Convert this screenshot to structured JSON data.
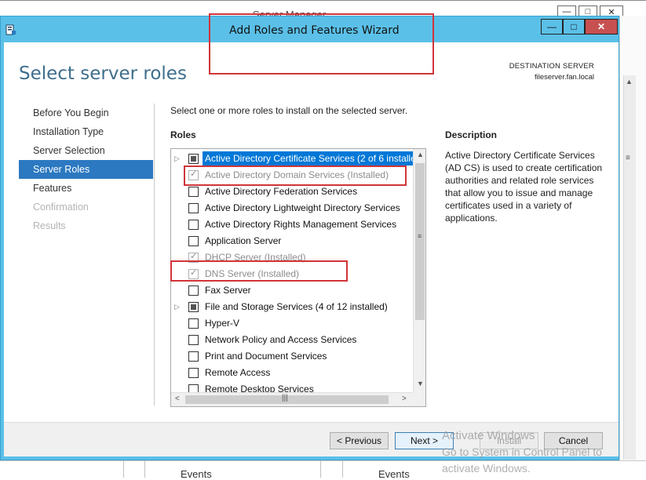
{
  "server_manager": {
    "title": "Server Manager",
    "events_label": "Events",
    "controls": {
      "minimize": "—",
      "maximize": "□",
      "close": "✕"
    }
  },
  "wizard": {
    "title": "Add Roles and Features Wizard",
    "controls": {
      "minimize": "—",
      "maximize": "□",
      "close": "✕"
    },
    "page_title": "Select server roles",
    "destination": {
      "label": "DESTINATION SERVER",
      "server": "fileserver.fan.local"
    },
    "nav": [
      {
        "label": "Before You Begin",
        "state": "normal"
      },
      {
        "label": "Installation Type",
        "state": "normal"
      },
      {
        "label": "Server Selection",
        "state": "normal"
      },
      {
        "label": "Server Roles",
        "state": "active"
      },
      {
        "label": "Features",
        "state": "normal"
      },
      {
        "label": "Confirmation",
        "state": "disabled"
      },
      {
        "label": "Results",
        "state": "disabled"
      }
    ],
    "instruction": "Select one or more roles to install on the selected server.",
    "roles_heading": "Roles",
    "roles": [
      {
        "label": "Active Directory Certificate Services (2 of 6 installe",
        "check": "partial",
        "expandable": true,
        "selected": true,
        "installed": false
      },
      {
        "label": "Active Directory Domain Services (Installed)",
        "check": "checked",
        "expandable": false,
        "selected": false,
        "installed": true
      },
      {
        "label": "Active Directory Federation Services",
        "check": "none",
        "expandable": false,
        "selected": false,
        "installed": false
      },
      {
        "label": "Active Directory Lightweight Directory Services",
        "check": "none",
        "expandable": false,
        "selected": false,
        "installed": false
      },
      {
        "label": "Active Directory Rights Management Services",
        "check": "none",
        "expandable": false,
        "selected": false,
        "installed": false
      },
      {
        "label": "Application Server",
        "check": "none",
        "expandable": false,
        "selected": false,
        "installed": false
      },
      {
        "label": "DHCP Server (Installed)",
        "check": "checked",
        "expandable": false,
        "selected": false,
        "installed": true
      },
      {
        "label": "DNS Server (Installed)",
        "check": "checked",
        "expandable": false,
        "selected": false,
        "installed": true
      },
      {
        "label": "Fax Server",
        "check": "none",
        "expandable": false,
        "selected": false,
        "installed": false
      },
      {
        "label": "File and Storage Services (4 of 12 installed)",
        "check": "partial",
        "expandable": true,
        "selected": false,
        "installed": false
      },
      {
        "label": "Hyper-V",
        "check": "none",
        "expandable": false,
        "selected": false,
        "installed": false
      },
      {
        "label": "Network Policy and Access Services",
        "check": "none",
        "expandable": false,
        "selected": false,
        "installed": false
      },
      {
        "label": "Print and Document Services",
        "check": "none",
        "expandable": false,
        "selected": false,
        "installed": false
      },
      {
        "label": "Remote Access",
        "check": "none",
        "expandable": false,
        "selected": false,
        "installed": false
      },
      {
        "label": "Remote Desktop Services",
        "check": "none",
        "expandable": false,
        "selected": false,
        "installed": false
      }
    ],
    "description_heading": "Description",
    "description_text": "Active Directory Certificate Services (AD CS) is used to create certification authorities and related role services that allow you to issue and manage certificates used in a variety of applications.",
    "buttons": {
      "previous": "< Previous",
      "next": "Next >",
      "install": "Install",
      "cancel": "Cancel"
    }
  },
  "watermark": {
    "line1": "Activate Windows",
    "line2": "Go to System in Control Panel to",
    "line3": "activate Windows."
  },
  "colors": {
    "titlebar": "#5bc0e8",
    "nav_active": "#2c79c1",
    "page_title": "#3f6e8c",
    "annotation": "#d1343a"
  }
}
